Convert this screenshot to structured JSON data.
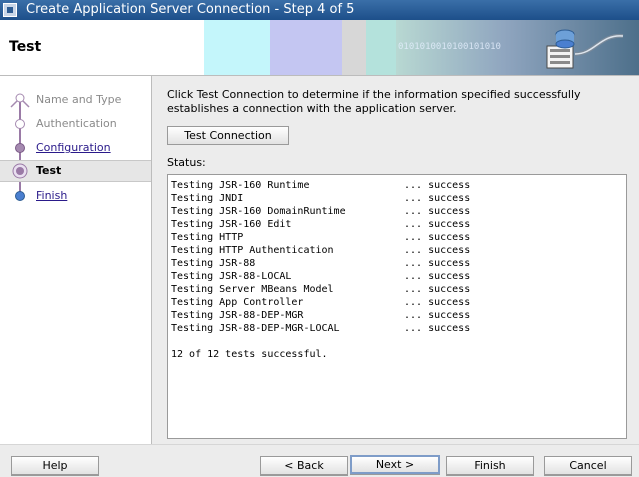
{
  "window": {
    "title": "Create Application Server Connection - Step 4 of 5"
  },
  "header": {
    "page_title": "Test",
    "binary_text": "0101010010100101010"
  },
  "nav": {
    "items": [
      {
        "label": "Name and Type",
        "state": "done"
      },
      {
        "label": "Authentication",
        "state": "done"
      },
      {
        "label": "Configuration",
        "state": "link"
      },
      {
        "label": "Test",
        "state": "current"
      },
      {
        "label": "Finish",
        "state": "link"
      }
    ]
  },
  "main": {
    "description": "Click Test Connection to determine if the information specified successfully establishes a connection with the application server.",
    "test_button": "Test Connection",
    "status_label": "Status:",
    "results": [
      {
        "test": "Testing JSR-160 Runtime",
        "result": "... success"
      },
      {
        "test": "Testing JNDI",
        "result": "... success"
      },
      {
        "test": "Testing JSR-160 DomainRuntime",
        "result": "... success"
      },
      {
        "test": "Testing JSR-160 Edit",
        "result": "... success"
      },
      {
        "test": "Testing HTTP",
        "result": "... success"
      },
      {
        "test": "Testing HTTP Authentication",
        "result": "... success"
      },
      {
        "test": "Testing JSR-88",
        "result": "... success"
      },
      {
        "test": "Testing JSR-88-LOCAL",
        "result": "... success"
      },
      {
        "test": "Testing Server MBeans Model",
        "result": "... success"
      },
      {
        "test": "Testing App Controller",
        "result": "... success"
      },
      {
        "test": "Testing JSR-88-DEP-MGR",
        "result": "... success"
      },
      {
        "test": "Testing JSR-88-DEP-MGR-LOCAL",
        "result": "... success"
      }
    ],
    "summary": "12 of 12 tests successful."
  },
  "footer": {
    "help": "Help",
    "back": "< Back",
    "next": "Next >",
    "finish": "Finish",
    "cancel": "Cancel"
  },
  "colors": {
    "titlebar": "#2d5c93",
    "nav_accent": "#9a7aa6",
    "link": "#2a1a8a",
    "current_node": "#4a7fd0"
  }
}
